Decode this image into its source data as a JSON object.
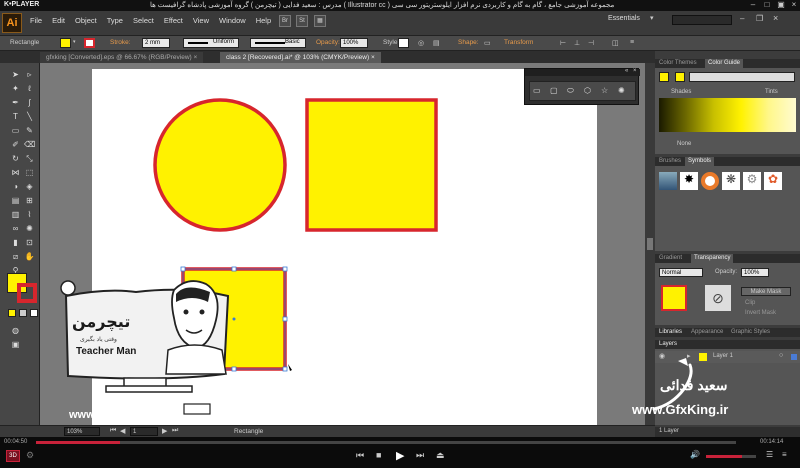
{
  "player": {
    "logo": "K•PLAYER",
    "title_bar_text": "مجموعه آموزشی جامع ، گام به گام و کاربردی نرم افزار ایلوستریتور سی سی ( Illustrator cc )    مدرس : سعید فدایی ( تیچرمن ) گروه آموزشی پادشاه گرافیست ها",
    "time_elapsed": "00:04:50",
    "time_total": "00:14:14",
    "progress_fraction": 0.12,
    "buttons": [
      "3D",
      "prev",
      "stop",
      "play",
      "next",
      "eject"
    ]
  },
  "ai": {
    "logo": "Ai",
    "menu": [
      "File",
      "Edit",
      "Object",
      "Type",
      "Select",
      "Effect",
      "View",
      "Window",
      "Help"
    ],
    "br_label": "Br",
    "st_label": "St",
    "workspace": "Essentials"
  },
  "control": {
    "selection_type": "Rectangle",
    "stroke_label": "Stroke:",
    "stroke_value": "2 mm",
    "profile": "Uniform",
    "brush": "Basic",
    "opacity_label": "Opacity:",
    "opacity_value": "100%",
    "style_label": "Style:",
    "shape_label": "Shape:",
    "transform_label": "Transform"
  },
  "tabs": [
    {
      "label": "gfxking [Converted].eps @ 66.67% (RGB/Preview)",
      "active": false
    },
    {
      "label": "class 2 [Recovered].ai* @ 103% (CMYK/Preview)",
      "active": true
    }
  ],
  "status": {
    "zoom": "103%",
    "artboard": "1",
    "tool": "Rectangle"
  },
  "panels": {
    "color_themes": "Color Themes",
    "color_guide": "Color Guide",
    "shades": "Shades",
    "tints": "Tints",
    "none": "None",
    "brushes": "Brushes",
    "symbols": "Symbols",
    "gradient": "Gradient",
    "transparency": "Transparency",
    "blend_mode": "Normal",
    "opacity_label": "Opacity:",
    "opacity_value": "100%",
    "make_mask": "Make Mask",
    "clip": "Clip",
    "invert_mask": "Invert Mask",
    "libraries": "Libraries",
    "appearance": "Appearance",
    "graphic_styles": "Graphic Styles",
    "layers": "Layers",
    "layer_name": "Layer 1",
    "layer_count": "1 Layer"
  },
  "watermark": {
    "logo_fa": "تیچرمن",
    "tagline_fa": "وقتی یاد بگیری",
    "name_en": "Teacher Man",
    "url": "www.TeacherMan.ir",
    "author_fa": "سعید فدائی",
    "site": "www.GfxKing.ir"
  },
  "colors": {
    "yellow": "#fff200",
    "red": "#d7262d",
    "accent": "#c8223a"
  }
}
